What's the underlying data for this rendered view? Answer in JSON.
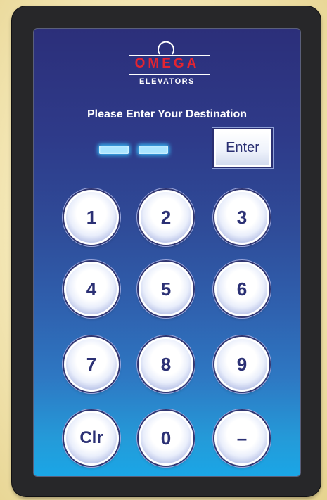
{
  "logo": {
    "brand": "OMEGA",
    "subtitle": "ELEVATORS"
  },
  "prompt": "Please Enter Your Destination",
  "display": {
    "digits": [
      "",
      ""
    ]
  },
  "enter_label": "Enter",
  "keys": [
    {
      "label": "1"
    },
    {
      "label": "2"
    },
    {
      "label": "3"
    },
    {
      "label": "4"
    },
    {
      "label": "5"
    },
    {
      "label": "6"
    },
    {
      "label": "7"
    },
    {
      "label": "8"
    },
    {
      "label": "9"
    },
    {
      "label": "Clr"
    },
    {
      "label": "0"
    },
    {
      "label": "–"
    }
  ],
  "colors": {
    "brand_red": "#e42431",
    "key_text": "#2b3074",
    "display_glow": "#38b8f3"
  }
}
